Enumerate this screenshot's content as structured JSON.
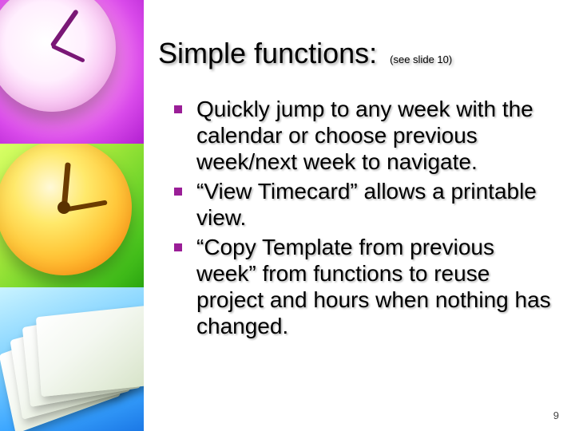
{
  "title": "Simple functions:",
  "subtitle": "(see slide 10)",
  "bullets": [
    "Quickly jump to any week with the calendar or choose previous week/next week to navigate.",
    "“View Timecard” allows a printable view.",
    "“Copy Template from previous week” from functions to reuse project and hours when nothing has changed."
  ],
  "page_number": "9",
  "sidebar_images": [
    {
      "name": "pink-clock-image"
    },
    {
      "name": "yellow-clock-image"
    },
    {
      "name": "paper-stack-image"
    }
  ]
}
